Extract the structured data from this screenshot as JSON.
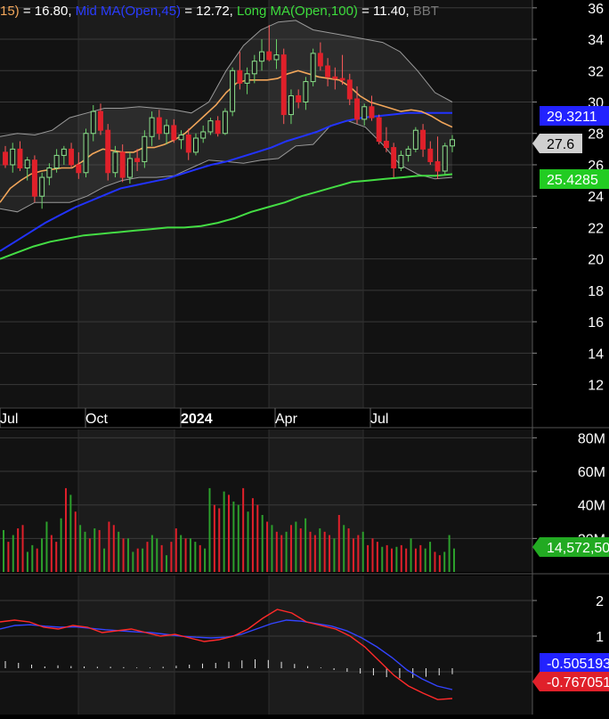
{
  "header": {
    "parts": [
      {
        "text": "15)",
        "color": "#f2a65a"
      },
      {
        "text": " = 16.80, ",
        "color": "#ffffff"
      },
      {
        "text": "Mid MA(Open,45)",
        "color": "#2a3cff"
      },
      {
        "text": " = 12.72, ",
        "color": "#ffffff"
      },
      {
        "text": "Long MA(Open,100)",
        "color": "#3ddc3d"
      },
      {
        "text": " = 11.40, ",
        "color": "#ffffff"
      },
      {
        "text": "BBT",
        "color": "#777777"
      }
    ]
  },
  "colors": {
    "background": "#000000",
    "panel_alt": "#1a1a1a",
    "grid": "#3a3a3a",
    "up": "#2ca02c",
    "down": "#e0202a",
    "short_ma": "#f2a65a",
    "mid_ma": "#2233ff",
    "long_ma": "#44dd44",
    "bbands": "#9a9a9a",
    "macd": "#ff2a2a",
    "signal": "#3344ff"
  },
  "chart_data": [
    {
      "type": "candlestick",
      "name": "price",
      "x_labels": [
        "Jul",
        "Oct",
        "2024",
        "Apr",
        "Jul"
      ],
      "y_ticks": [
        12,
        14,
        16,
        18,
        20,
        22,
        24,
        26,
        28,
        30,
        32,
        34,
        36
      ],
      "ylim": [
        10.5,
        36.5
      ],
      "markers": [
        {
          "text": "29.3211",
          "value": 29.3,
          "color": "#2222ff",
          "text_color": "#ffffff"
        },
        {
          "text": "27.6",
          "value": 27.6,
          "color": "#d0d0d0",
          "text_color": "#000000"
        },
        {
          "text": "25.4285",
          "value": 25.4,
          "color": "#22cc22",
          "text_color": "#ffffff"
        }
      ],
      "candles": [
        [
          26.8,
          27.2,
          25.8,
          26.0
        ],
        [
          26.0,
          27.4,
          25.5,
          27.0
        ],
        [
          27.0,
          27.5,
          25.6,
          25.8
        ],
        [
          25.8,
          26.5,
          25.0,
          26.3
        ],
        [
          26.3,
          26.6,
          23.6,
          24.0
        ],
        [
          24.0,
          25.5,
          23.2,
          25.2
        ],
        [
          25.2,
          26.1,
          24.7,
          25.8
        ],
        [
          25.8,
          27.0,
          25.5,
          26.6
        ],
        [
          26.6,
          27.2,
          26.0,
          27.0
        ],
        [
          27.0,
          27.4,
          25.8,
          26.0
        ],
        [
          26.0,
          26.8,
          25.1,
          25.5
        ],
        [
          25.5,
          28.3,
          25.2,
          28.0
        ],
        [
          28.0,
          29.8,
          27.5,
          29.4
        ],
        [
          29.4,
          29.9,
          27.9,
          28.2
        ],
        [
          28.2,
          28.6,
          25.0,
          25.5
        ],
        [
          25.5,
          27.2,
          25.2,
          26.8
        ],
        [
          26.8,
          27.3,
          24.9,
          25.2
        ],
        [
          25.2,
          26.8,
          24.8,
          26.4
        ],
        [
          26.4,
          27.0,
          25.6,
          26.2
        ],
        [
          26.2,
          28.2,
          25.8,
          27.8
        ],
        [
          27.8,
          29.4,
          27.2,
          29.0
        ],
        [
          29.0,
          29.5,
          27.6,
          28.0
        ],
        [
          28.0,
          28.9,
          27.3,
          28.5
        ],
        [
          28.5,
          28.9,
          27.4,
          27.6
        ],
        [
          27.6,
          28.2,
          27.0,
          27.9
        ],
        [
          27.9,
          28.3,
          26.3,
          26.8
        ],
        [
          26.8,
          28.0,
          26.6,
          27.7
        ],
        [
          27.7,
          28.5,
          27.4,
          28.1
        ],
        [
          28.1,
          29.0,
          27.9,
          28.8
        ],
        [
          28.8,
          29.1,
          27.8,
          28.0
        ],
        [
          28.0,
          29.6,
          27.9,
          29.4
        ],
        [
          29.4,
          32.2,
          29.1,
          32.0
        ],
        [
          32.0,
          33.2,
          30.8,
          31.2
        ],
        [
          31.2,
          32.2,
          30.5,
          31.8
        ],
        [
          31.8,
          33.0,
          31.2,
          32.6
        ],
        [
          32.6,
          34.0,
          32.0,
          33.2
        ],
        [
          33.2,
          34.9,
          32.6,
          32.7
        ],
        [
          32.7,
          34.0,
          32.1,
          33.0
        ],
        [
          33.0,
          33.4,
          28.6,
          29.2
        ],
        [
          29.2,
          30.8,
          28.6,
          30.4
        ],
        [
          30.4,
          30.8,
          29.6,
          30.0
        ],
        [
          30.0,
          31.6,
          29.5,
          31.3
        ],
        [
          31.3,
          33.4,
          31.0,
          33.1
        ],
        [
          33.1,
          33.8,
          32.0,
          32.3
        ],
        [
          32.3,
          32.8,
          31.0,
          31.6
        ],
        [
          31.6,
          32.2,
          30.8,
          31.5
        ],
        [
          31.5,
          33.0,
          31.1,
          31.4
        ],
        [
          31.4,
          31.8,
          29.8,
          30.2
        ],
        [
          30.2,
          31.0,
          28.6,
          28.9
        ],
        [
          28.9,
          29.9,
          28.5,
          29.7
        ],
        [
          29.7,
          30.4,
          28.8,
          29.0
        ],
        [
          29.0,
          29.2,
          27.3,
          27.5
        ],
        [
          27.5,
          28.4,
          26.8,
          27.1
        ],
        [
          27.1,
          27.4,
          25.2,
          25.8
        ],
        [
          25.8,
          26.9,
          25.6,
          26.6
        ],
        [
          26.6,
          27.2,
          26.2,
          27.0
        ],
        [
          27.0,
          28.4,
          26.8,
          28.2
        ],
        [
          28.2,
          28.6,
          26.5,
          27.0
        ],
        [
          27.0,
          27.5,
          26.0,
          26.2
        ],
        [
          26.2,
          27.8,
          25.1,
          25.6
        ],
        [
          25.6,
          27.4,
          25.4,
          27.2
        ],
        [
          27.2,
          27.9,
          26.8,
          27.6
        ]
      ],
      "series": [
        {
          "key": "short_ma",
          "values": [
            23.6,
            24.5,
            25.0,
            25.4,
            25.6,
            25.7,
            25.8,
            25.8,
            26.2,
            26.7,
            27.0,
            26.9,
            26.8,
            26.8,
            27.1,
            27.1,
            27.3,
            27.6,
            28.0,
            28.6,
            29.2,
            29.8,
            30.6,
            31.2,
            31.4,
            31.4,
            31.4,
            31.5,
            31.8,
            32.0,
            31.8,
            31.6,
            31.5,
            31.4,
            31.0,
            30.4,
            30.0,
            29.8,
            29.6,
            29.4,
            29.5,
            29.4,
            29.1,
            28.7,
            28.4
          ]
        },
        {
          "key": "mid_ma",
          "values": [
            20.5,
            21.1,
            21.7,
            22.3,
            22.8,
            23.3,
            23.7,
            24.1,
            24.5,
            24.7,
            24.9,
            25.1,
            25.4,
            25.7,
            26.0,
            26.2,
            26.5,
            26.8,
            27.1,
            27.5,
            27.8,
            28.1,
            28.5,
            28.8,
            29.0,
            29.1,
            29.2,
            29.3,
            29.3,
            29.3,
            29.3
          ]
        },
        {
          "key": "long_ma",
          "values": [
            20.0,
            20.4,
            20.8,
            21.1,
            21.3,
            21.5,
            21.6,
            21.7,
            21.8,
            21.9,
            22.0,
            22.0,
            22.1,
            22.3,
            22.6,
            23.0,
            23.3,
            23.6,
            24.0,
            24.3,
            24.6,
            24.9,
            25.0,
            25.1,
            25.2,
            25.3,
            25.3,
            25.4
          ]
        },
        {
          "key": "bb_upper",
          "values": [
            27.8,
            28.0,
            27.9,
            28.2,
            29.0,
            29.3,
            29.6,
            29.6,
            29.7,
            29.6,
            29.5,
            29.3,
            30.0,
            32.0,
            33.6,
            34.6,
            35.1,
            35.2,
            34.6,
            34.4,
            34.2,
            34.0,
            33.8,
            33.2,
            32.0,
            30.6,
            30.0
          ]
        },
        {
          "key": "bb_lower",
          "values": [
            23.2,
            23.0,
            23.6,
            23.6,
            23.6,
            24.0,
            24.6,
            25.0,
            25.2,
            25.2,
            25.3,
            25.8,
            26.3,
            26.2,
            26.1,
            26.3,
            26.4,
            27.2,
            27.3,
            28.5,
            28.8,
            28.4,
            27.3,
            26.0,
            25.4,
            25.1,
            25.2
          ]
        }
      ]
    },
    {
      "type": "bar",
      "name": "volume",
      "y_ticks": [
        20,
        40,
        60,
        80
      ],
      "y_tick_labels": [
        "20M",
        "40M",
        "60M",
        "80M"
      ],
      "ylim": [
        0,
        85
      ],
      "unit": "M",
      "marker": {
        "text": "14,572,50",
        "value": 14.6,
        "color": "#22aa22"
      },
      "values": [
        25,
        18,
        22,
        26,
        28,
        12,
        16,
        14,
        20,
        30,
        22,
        18,
        32,
        50,
        46,
        36,
        28,
        24,
        20,
        26,
        25,
        14,
        30,
        28,
        24,
        20,
        20,
        12,
        14,
        14,
        18,
        22,
        20,
        16,
        10,
        18,
        26,
        22,
        20,
        20,
        18,
        16,
        14,
        50,
        40,
        38,
        48,
        46,
        42,
        40,
        50,
        36,
        44,
        40,
        34,
        30,
        28,
        24,
        22,
        24,
        28,
        30,
        26,
        32,
        24,
        22,
        26,
        24,
        22,
        20,
        34,
        28,
        26,
        20,
        22,
        24,
        16,
        20,
        18,
        15,
        16,
        14,
        15,
        16,
        14,
        20,
        14,
        16,
        14,
        18,
        12,
        10,
        12,
        22,
        14
      ],
      "up": [
        1,
        0,
        1,
        0,
        0,
        1,
        1,
        0,
        1,
        1,
        0,
        0,
        1,
        0,
        1,
        0,
        1,
        1,
        0,
        1,
        0,
        1,
        0,
        0,
        1,
        0,
        1,
        1,
        0,
        1,
        0,
        1,
        1,
        0,
        1,
        0,
        0,
        1,
        0,
        1,
        1,
        0,
        1,
        1,
        0,
        0,
        1,
        0,
        1,
        1,
        0,
        1,
        0,
        0,
        1,
        0,
        1,
        0,
        0,
        1,
        0,
        1,
        0,
        1,
        0,
        0,
        1,
        0,
        0,
        1,
        0,
        1,
        0,
        0,
        0,
        1,
        0,
        0,
        0,
        1,
        0,
        0,
        1,
        0,
        0,
        1,
        0,
        0,
        1,
        1,
        0,
        0,
        1,
        1,
        1
      ]
    },
    {
      "type": "line",
      "name": "macd",
      "y_ticks": [
        1,
        2
      ],
      "ylim": [
        -1.2,
        2.7
      ],
      "markers": [
        {
          "text": "-0.505193",
          "value": -0.5,
          "color": "#2222ff"
        },
        {
          "text": "-0.767051",
          "value": -0.77,
          "color": "#e0202a"
        }
      ],
      "series": [
        {
          "key": "macd_line",
          "values": [
            1.4,
            1.45,
            1.4,
            1.25,
            1.2,
            1.3,
            1.25,
            1.1,
            1.15,
            1.2,
            1.1,
            1.0,
            1.05,
            0.95,
            0.85,
            0.9,
            1.0,
            1.2,
            1.5,
            1.75,
            1.65,
            1.4,
            1.3,
            1.2,
            1.0,
            0.7,
            0.3,
            -0.1,
            -0.4,
            -0.6,
            -0.78,
            -0.75
          ]
        },
        {
          "key": "signal_line",
          "values": [
            1.2,
            1.3,
            1.32,
            1.28,
            1.25,
            1.26,
            1.22,
            1.18,
            1.15,
            1.12,
            1.1,
            1.05,
            1.0,
            0.97,
            0.95,
            0.97,
            1.05,
            1.2,
            1.35,
            1.45,
            1.42,
            1.35,
            1.28,
            1.15,
            0.95,
            0.7,
            0.4,
            0.05,
            -0.2,
            -0.4,
            -0.5
          ]
        },
        {
          "key": "histogram",
          "values": [
            0.2,
            0.15,
            0.1,
            0.05,
            0.08,
            0.06,
            0.05,
            0.04,
            0.04,
            0.03,
            0.02,
            0.02,
            0.04,
            0.07,
            0.1,
            0.13,
            0.15,
            0.18,
            0.22,
            0.25,
            0.23,
            0.18,
            0.12,
            0.06,
            0.02,
            -0.05,
            -0.1,
            -0.15,
            -0.2,
            -0.25,
            -0.28,
            -0.27,
            -0.24,
            -0.2,
            -0.17
          ]
        }
      ]
    }
  ]
}
